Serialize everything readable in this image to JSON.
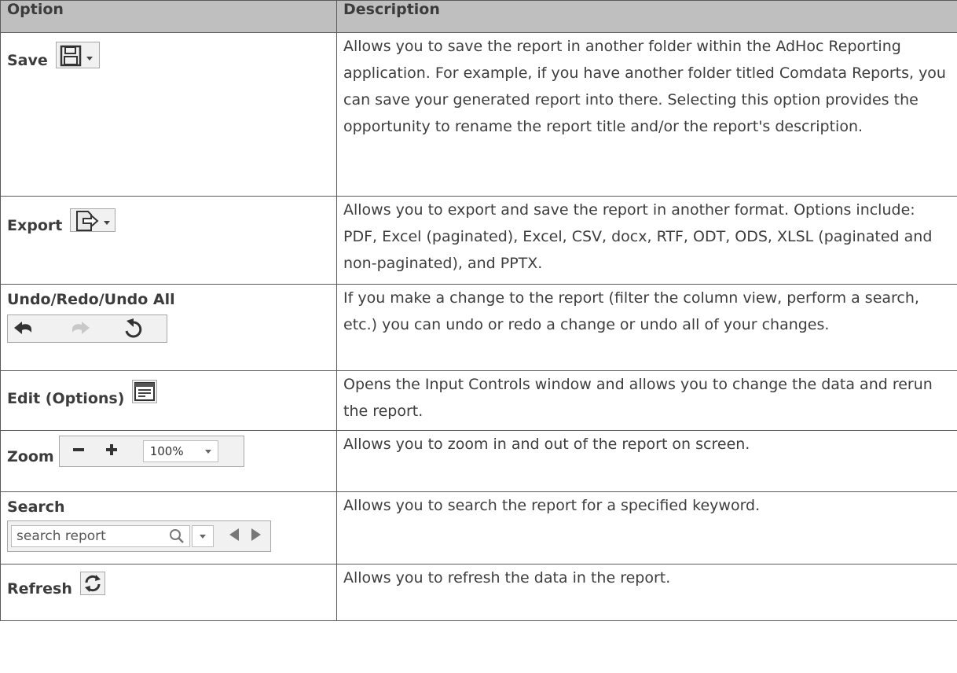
{
  "header": {
    "option": "Option",
    "description": "Description"
  },
  "rows": [
    {
      "label": "Save",
      "icon": "floppy-disk-icon",
      "description": "Allows you to save the report in another folder within the AdHoc Reporting application. For example, if you have another folder titled Comdata Reports, you can save your generated report into there. Selecting this option provides the opportunity to rename the report title and/or the report's description."
    },
    {
      "label": "Export",
      "icon": "export-icon",
      "description": "Allows you to export and save the report in another format. Options include: PDF, Excel (paginated), Excel, CSV, docx, RTF, ODT, ODS, XLSL (paginated and non-paginated), and PPTX."
    },
    {
      "label": "Undo/Redo/Undo All",
      "icon": "undo-redo-icons",
      "description": "If you make a change to the report (filter the column view, perform a search, etc.) you can undo or redo a change or undo all of your changes."
    },
    {
      "label": "Edit (Options)",
      "icon": "options-icon",
      "description": "Opens the Input Controls window and allows you to change the data and rerun the report."
    },
    {
      "label": "Zoom",
      "icon": "zoom-controls",
      "zoom_value": "100%",
      "description": "Allows you to zoom in and out of the report on screen."
    },
    {
      "label": "Search",
      "icon": "search-controls",
      "search_placeholder": "search report",
      "description": "Allows you to search the report for a specified keyword."
    },
    {
      "label": "Refresh",
      "icon": "refresh-icon",
      "description": "Allows you to refresh the data in the report."
    }
  ]
}
